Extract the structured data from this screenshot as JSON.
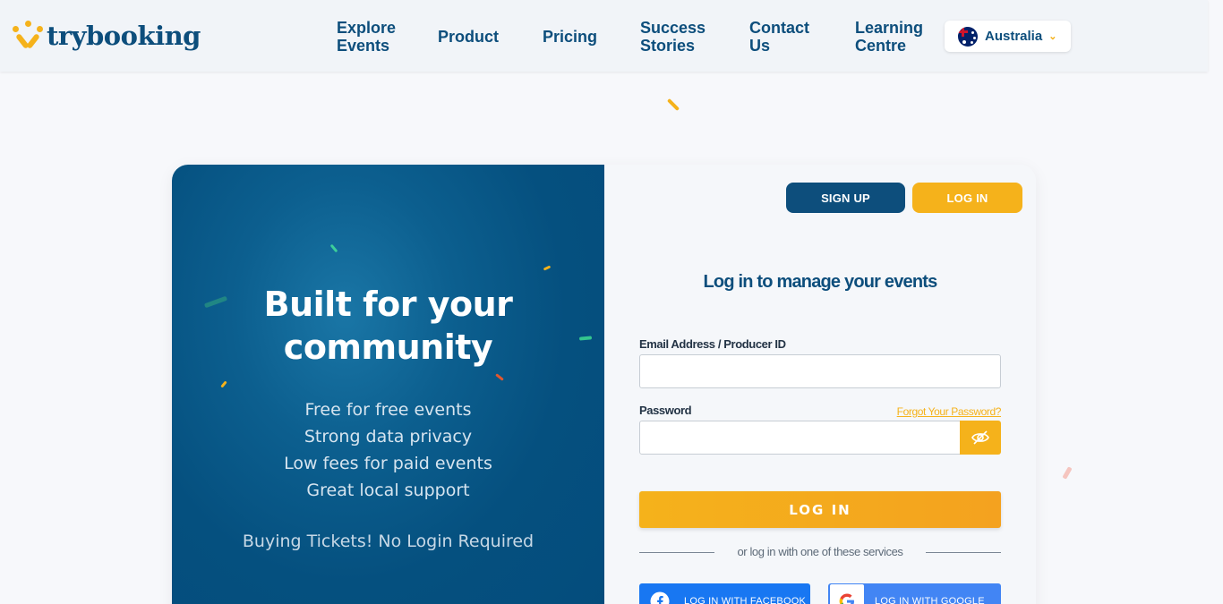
{
  "header": {
    "logo_text": "trybooking",
    "nav": [
      {
        "line1": "Explore",
        "line2": "Events"
      },
      {
        "line1": "Product",
        "line2": ""
      },
      {
        "line1": "Pricing",
        "line2": ""
      },
      {
        "line1": "Success",
        "line2": "Stories"
      },
      {
        "line1": "Contact",
        "line2": "Us"
      },
      {
        "line1": "Learning",
        "line2": "Centre"
      }
    ],
    "country": {
      "label": "Australia",
      "flag_icon": "australia-flag-icon",
      "chevron_icon": "chevron-down-icon"
    }
  },
  "hero": {
    "title_line1": "Built for your",
    "title_line2": "community",
    "features": [
      "Free for free events",
      "Strong data privacy",
      "Low fees for paid events",
      "Great local support"
    ],
    "buying_note": "Buying Tickets! No Login Required"
  },
  "auth": {
    "signup_label": "SIGN UP",
    "login_tab_label": "LOG IN",
    "form_title": "Log in to manage your events",
    "email_label": "Email Address / Producer ID",
    "email_value": "",
    "password_label": "Password",
    "password_value": "",
    "forgot_label": "Forgot Your Password?",
    "eye_icon": "eye-slash-icon",
    "submit_label": "LOG IN",
    "separator_text": "or log in with one of these services",
    "facebook_label": "LOG IN WITH FACEBOOK",
    "google_label": "LOG IN WITH GOOGLE"
  },
  "colors": {
    "brand_navy": "#0d4e7c",
    "brand_yellow": "#f5b21b",
    "facebook_blue": "#1877f2",
    "google_blue": "#4285f4"
  }
}
